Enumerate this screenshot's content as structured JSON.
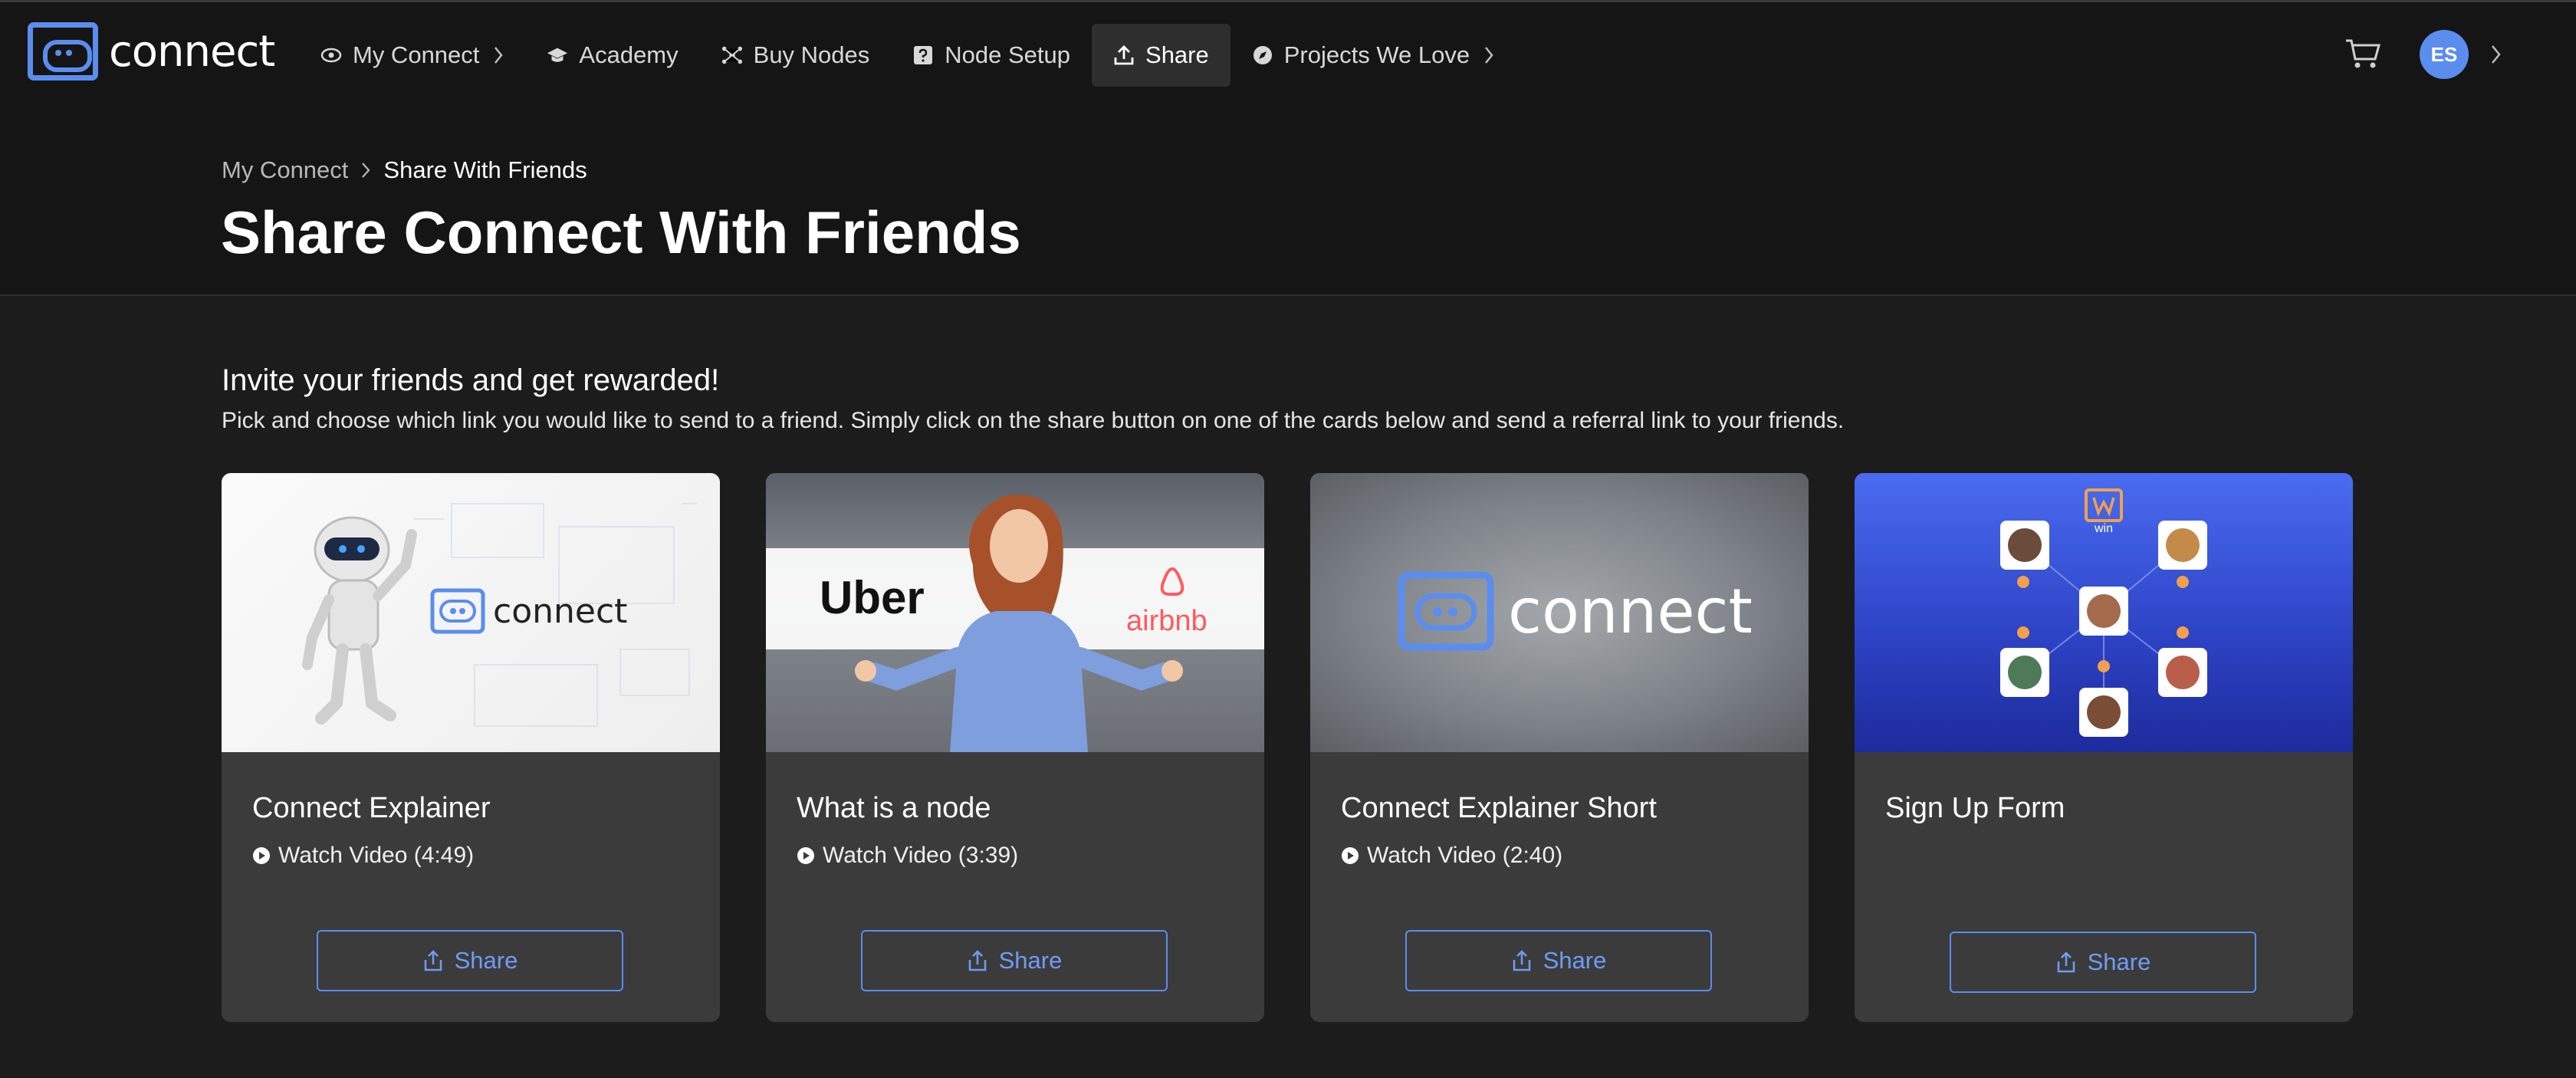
{
  "app": {
    "logo_text": "connect"
  },
  "nav": {
    "items": [
      {
        "label": "My Connect",
        "icon": "eye-icon",
        "chevron": true
      },
      {
        "label": "Academy",
        "icon": "graduation-cap-icon",
        "chevron": false
      },
      {
        "label": "Buy Nodes",
        "icon": "network-icon",
        "chevron": false
      },
      {
        "label": "Node Setup",
        "icon": "help-box-icon",
        "chevron": false
      },
      {
        "label": "Share",
        "icon": "upload-icon",
        "chevron": false,
        "active": true
      },
      {
        "label": "Projects We Love",
        "icon": "compass-icon",
        "chevron": true
      }
    ],
    "avatar_initials": "ES"
  },
  "breadcrumb": {
    "parent": "My Connect",
    "current": "Share With Friends"
  },
  "page": {
    "title": "Share Connect With Friends"
  },
  "intro": {
    "title": "Invite your friends and get rewarded!",
    "text": "Pick and choose which link you would like to send to a friend. Simply click on the share button on one of the cards below and send a referral link to your friends."
  },
  "cards": [
    {
      "title": "Connect Explainer",
      "watch": "Watch Video (4:49)",
      "share": "Share",
      "thumb_text": "connect"
    },
    {
      "title": "What is a node",
      "watch": "Watch Video (3:39)",
      "share": "Share",
      "thumb_left": "Uber",
      "thumb_right": "airbnb"
    },
    {
      "title": "Connect Explainer Short",
      "watch": "Watch Video (2:40)",
      "share": "Share",
      "thumb_text": "connect"
    },
    {
      "title": "Sign Up Form",
      "watch": "",
      "share": "Share",
      "thumb_text": "win"
    }
  ],
  "colors": {
    "accent": "#5b8def",
    "background": "#1c1c1c",
    "card": "#3b3b3b",
    "header": "#151515"
  }
}
